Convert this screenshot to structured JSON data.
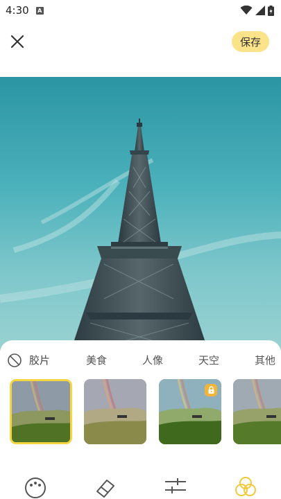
{
  "status_bar": {
    "time": "4:30",
    "notification_badge": "A"
  },
  "toolbar": {
    "save_label": "保存",
    "close_icon": "close-icon"
  },
  "photo": {
    "subject": "eiffel-tower-photo"
  },
  "categories": {
    "items": [
      {
        "label": "胶片",
        "active": true
      },
      {
        "label": "美食",
        "active": false
      },
      {
        "label": "人像",
        "active": false
      },
      {
        "label": "天空",
        "active": false
      },
      {
        "label": "其他",
        "active": false
      }
    ]
  },
  "filters": [
    {
      "selected": true,
      "locked": false
    },
    {
      "selected": false,
      "locked": false
    },
    {
      "selected": false,
      "locked": true
    },
    {
      "selected": false,
      "locked": false
    }
  ],
  "tabs": [
    "palette-icon",
    "eraser-icon",
    "adjust-sliders-icon",
    "filter-circles-icon"
  ],
  "colors": {
    "accent": "#f4d641",
    "save_bg": "#fbe38a",
    "active_tab": "#f2c93b",
    "lock_badge": "#f1b53a"
  }
}
